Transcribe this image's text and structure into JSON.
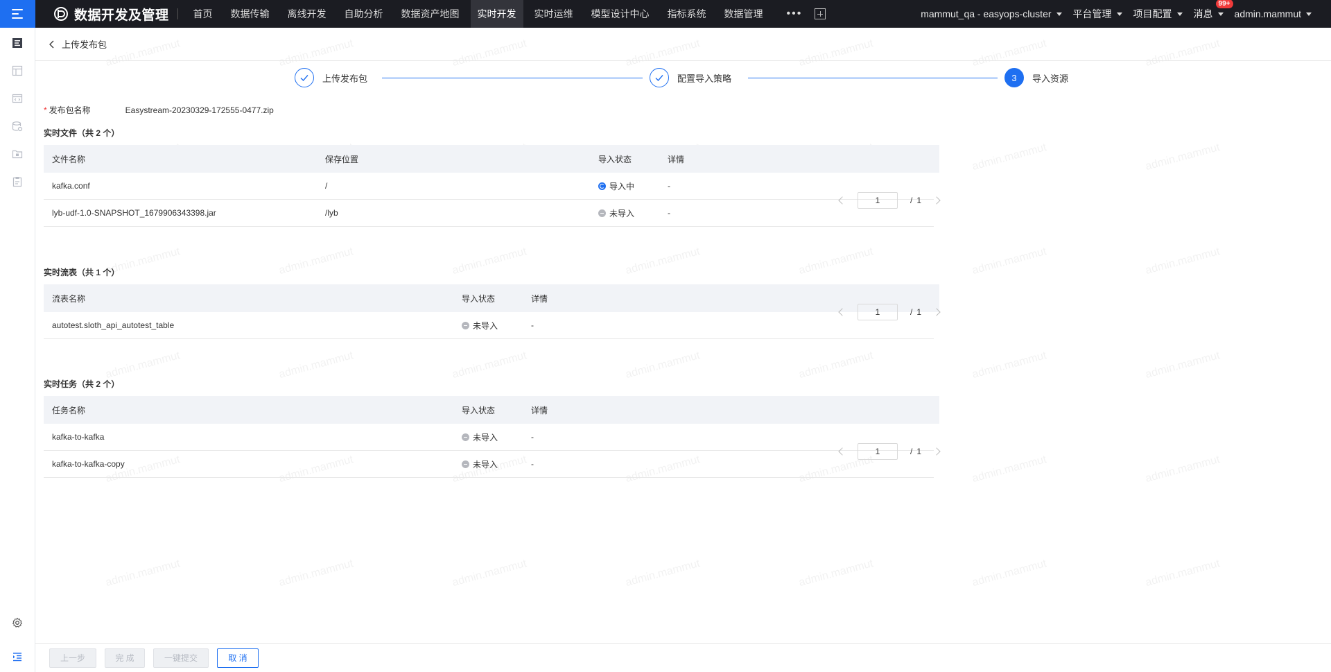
{
  "topnav": {
    "brand": "数据开发及管理",
    "items": [
      "首页",
      "数据传输",
      "离线开发",
      "自助分析",
      "数据资产地图",
      "实时开发",
      "实时运维",
      "模型设计中心",
      "指标系统",
      "数据管理"
    ],
    "active_index": 5,
    "more": "•••",
    "cluster": "mammut_qa - easyops-cluster",
    "platform": "平台管理",
    "project": "项目配置",
    "messages": "消息",
    "message_badge": "99+",
    "user": "admin.mammut"
  },
  "page": {
    "title": "上传发布包"
  },
  "steps": [
    {
      "label": "上传发布包",
      "state": "done"
    },
    {
      "label": "配置导入策略",
      "state": "done"
    },
    {
      "label": "导入资源",
      "state": "current",
      "number": "3"
    }
  ],
  "package": {
    "label": "发布包名称",
    "value": "Easystream-20230329-172555-0477.zip"
  },
  "files": {
    "title": "实时文件（共 2 个）",
    "headers": [
      "文件名称",
      "保存位置",
      "导入状态",
      "详情"
    ],
    "rows": [
      {
        "name": "kafka.conf",
        "location": "/",
        "status": "导入中",
        "status_type": "importing",
        "detail": "-"
      },
      {
        "name": "lyb-udf-1.0-SNAPSHOT_1679906343398.jar",
        "location": "/lyb",
        "status": "未导入",
        "status_type": "none",
        "detail": "-"
      }
    ],
    "page": "1",
    "total": "1"
  },
  "streams": {
    "title": "实时流表（共 1 个）",
    "headers": [
      "流表名称",
      "导入状态",
      "详情"
    ],
    "rows": [
      {
        "name": "autotest.sloth_api_autotest_table",
        "status": "未导入",
        "status_type": "none",
        "detail": "-"
      }
    ],
    "page": "1",
    "total": "1"
  },
  "tasks": {
    "title": "实时任务（共 2 个）",
    "headers": [
      "任务名称",
      "导入状态",
      "详情"
    ],
    "rows": [
      {
        "name": "kafka-to-kafka",
        "status": "未导入",
        "status_type": "none",
        "detail": "-"
      },
      {
        "name": "kafka-to-kafka-copy",
        "status": "未导入",
        "status_type": "none",
        "detail": "-"
      }
    ],
    "page": "1",
    "total": "1"
  },
  "footer": {
    "prev": "上一步",
    "finish": "完 成",
    "submit": "一键提交",
    "cancel": "取 消"
  },
  "watermark": "admin.mammut",
  "colors": {
    "primary": "#1e6ff1",
    "nav_bg": "#1b1c22",
    "badge": "#f03a3a"
  }
}
